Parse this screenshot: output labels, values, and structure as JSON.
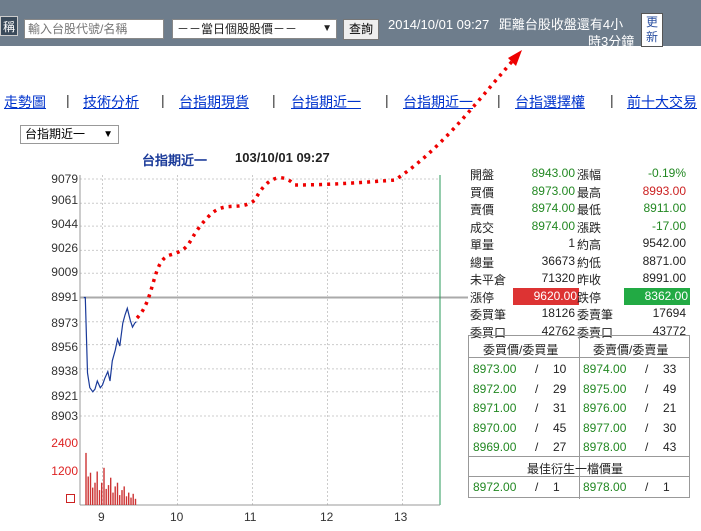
{
  "topbar": {
    "stub_label": "稱",
    "search_placeholder": "輸入台股代號/名稱",
    "dropdown_value": "－－當日個股股價－－",
    "query_label": "查詢",
    "datetime": "2014/10/01 09:27",
    "countdown_line1": "距離台股收盤還有4小",
    "countdown_line2": "時3分鐘",
    "refresh_label_1": "更",
    "refresh_label_2": "新"
  },
  "nav": {
    "items": [
      "走勢圖",
      "技術分析",
      "台指期現貨",
      "台指期近一",
      "台指期近一",
      "台指選擇權",
      "前十大交易"
    ],
    "separator": "|"
  },
  "chart_controls": {
    "selector_value": "台指期近一"
  },
  "chart_header": {
    "title": "台指期近一",
    "time": "103/10/01 09:27"
  },
  "chart_data": {
    "type": "line",
    "price_axis": [
      "9079",
      "9061",
      "9044",
      "9026",
      "9009",
      "8991",
      "8973",
      "8956",
      "8938",
      "8921",
      "8903"
    ],
    "volume_axis": [
      "2400",
      "1200"
    ],
    "x_ticks": [
      "9",
      "10",
      "11",
      "12",
      "13"
    ],
    "reference_price": 8991,
    "ylim": [
      8903,
      9079
    ],
    "price_series": {
      "x": [
        8.75,
        8.77,
        8.8,
        8.83,
        8.87,
        8.9,
        8.93,
        8.97,
        9.0,
        9.03,
        9.07,
        9.1,
        9.13,
        9.17,
        9.2,
        9.23,
        9.27,
        9.3,
        9.33,
        9.37,
        9.4,
        9.43,
        9.45
      ],
      "y": [
        8991,
        8991,
        8935,
        8924,
        8921,
        8923,
        8929,
        8924,
        8926,
        8931,
        8936,
        8929,
        8944,
        8952,
        8960,
        8955,
        8972,
        8978,
        8983,
        8974,
        8969,
        8972,
        8973
      ]
    },
    "volume_series": {
      "x": [
        8.77,
        8.8,
        8.83,
        8.86,
        8.89,
        8.92,
        8.95,
        8.98,
        9.01,
        9.04,
        9.07,
        9.1,
        9.13,
        9.16,
        9.19,
        9.22,
        9.25,
        9.28,
        9.31,
        9.34,
        9.37,
        9.4,
        9.43
      ],
      "y": [
        2100,
        1150,
        1300,
        700,
        900,
        1350,
        600,
        900,
        1500,
        650,
        800,
        1100,
        500,
        750,
        900,
        400,
        600,
        750,
        350,
        500,
        300,
        450,
        250
      ]
    },
    "volume_ylim": [
      0,
      2700
    ],
    "xlim": [
      8.7,
      13.5
    ]
  },
  "quote": {
    "rows": [
      {
        "l1": "開盤",
        "v1": "8943.00",
        "c1": "green",
        "l2": "漲幅",
        "v2": "-0.19%",
        "c2": "green"
      },
      {
        "l1": "買價",
        "v1": "8973.00",
        "c1": "green",
        "l2": "最高",
        "v2": "8993.00",
        "c2": "red"
      },
      {
        "l1": "賣價",
        "v1": "8974.00",
        "c1": "green",
        "l2": "最低",
        "v2": "8911.00",
        "c2": "green"
      },
      {
        "l1": "成交",
        "v1": "8974.00",
        "c1": "green",
        "l2": "漲跌",
        "v2": "-17.00",
        "c2": "green"
      },
      {
        "l1": "單量",
        "v1": "1",
        "c1": "dark",
        "l2": "約高",
        "v2": "9542.00",
        "c2": "dark"
      },
      {
        "l1": "總量",
        "v1": "36673",
        "c1": "dark",
        "l2": "約低",
        "v2": "8871.00",
        "c2": "dark"
      },
      {
        "l1": "未平倉",
        "v1": "71320",
        "c1": "dark",
        "l2": "昨收",
        "v2": "8991.00",
        "c2": "dark"
      },
      {
        "l1": "漲停",
        "v1": "9620.00",
        "c1": "badge-red",
        "l2": "跌停",
        "v2": "8362.00",
        "c2": "badge-green"
      },
      {
        "l1": "委買筆",
        "v1": "18126",
        "c1": "dark",
        "l2": "委賣筆",
        "v2": "17694",
        "c2": "dark"
      },
      {
        "l1": "委買口",
        "v1": "42762",
        "c1": "dark",
        "l2": "委賣口",
        "v2": "43772",
        "c2": "dark"
      }
    ]
  },
  "orderbook": {
    "bid_header": "委買價/委買量",
    "ask_header": "委賣價/委賣量",
    "rows": [
      {
        "bid_price": "8973.00",
        "bid_qty": "10",
        "ask_price": "8974.00",
        "ask_qty": "33"
      },
      {
        "bid_price": "8972.00",
        "bid_qty": "29",
        "ask_price": "8975.00",
        "ask_qty": "49"
      },
      {
        "bid_price": "8971.00",
        "bid_qty": "31",
        "ask_price": "8976.00",
        "ask_qty": "21"
      },
      {
        "bid_price": "8970.00",
        "bid_qty": "45",
        "ask_price": "8977.00",
        "ask_qty": "30"
      },
      {
        "bid_price": "8969.00",
        "bid_qty": "27",
        "ask_price": "8978.00",
        "ask_qty": "43"
      }
    ],
    "derived_header": "最佳衍生一檔價量",
    "derived": {
      "bid_price": "8972.00",
      "bid_qty": "1",
      "ask_price": "8978.00",
      "ask_qty": "1"
    },
    "slash": "/"
  },
  "colors": {
    "green": "#228822",
    "red": "#cc2222",
    "badge_red": "#dd3333",
    "badge_green": "#22aa44",
    "dotted_arrow": "#ee0000",
    "price_line": "#1a3a99",
    "volume": "#cc3333"
  }
}
